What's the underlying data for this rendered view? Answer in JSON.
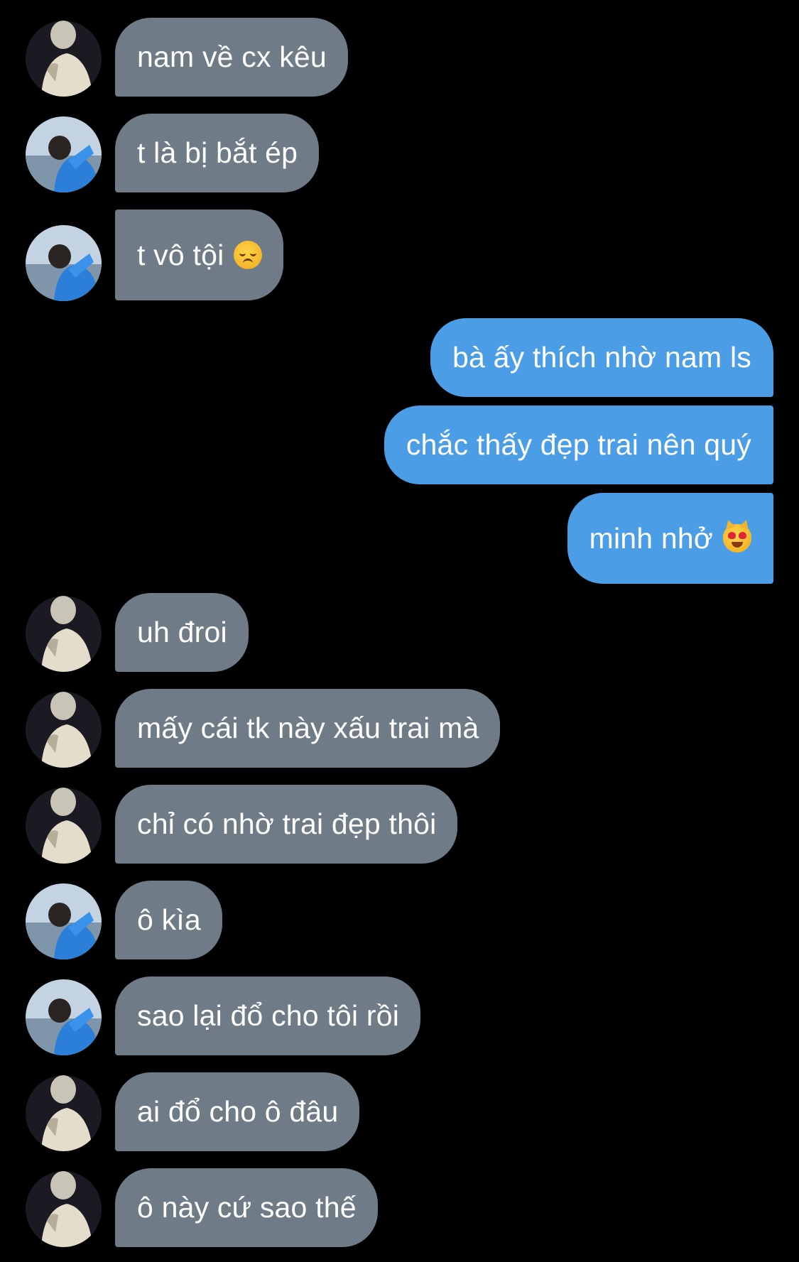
{
  "conversation": {
    "messages": [
      {
        "side": "in",
        "avatar": "dark-portrait-avatar",
        "text": "nam về cx kêu",
        "emoji": ""
      },
      {
        "side": "in",
        "avatar": "blue-jacket-avatar",
        "text": "t là bị bắt ép",
        "emoji": ""
      },
      {
        "side": "in",
        "avatar": "blue-jacket-avatar",
        "text": "t vô tội",
        "emoji": "disappointed-face-emoji"
      },
      {
        "side": "out",
        "avatar": "",
        "text": "bà ấy thích nhờ nam ls",
        "emoji": ""
      },
      {
        "side": "out",
        "avatar": "",
        "text": "chắc thấy đẹp trai nên quý",
        "emoji": ""
      },
      {
        "side": "out",
        "avatar": "",
        "text": "minh nhở",
        "emoji": "heart-eyes-cat-emoji"
      },
      {
        "side": "in",
        "avatar": "dark-portrait-avatar",
        "text": "uh đroi",
        "emoji": ""
      },
      {
        "side": "in",
        "avatar": "dark-portrait-avatar",
        "text": "mấy cái tk này xấu trai mà",
        "emoji": ""
      },
      {
        "side": "in",
        "avatar": "dark-portrait-avatar",
        "text": "chỉ có nhờ trai đẹp thôi",
        "emoji": ""
      },
      {
        "side": "in",
        "avatar": "blue-jacket-avatar",
        "text": "ô kìa",
        "emoji": ""
      },
      {
        "side": "in",
        "avatar": "blue-jacket-avatar",
        "text": "sao lại đổ cho tôi rồi",
        "emoji": ""
      },
      {
        "side": "in",
        "avatar": "dark-portrait-avatar",
        "text": "ai đổ cho ô đâu",
        "emoji": ""
      },
      {
        "side": "in",
        "avatar": "dark-portrait-avatar",
        "text": "ô này cứ sao thế",
        "emoji": ""
      }
    ]
  },
  "colors": {
    "background": "#000000",
    "incoming_bubble": "#6f7b87",
    "outgoing_bubble": "#4b9ee6",
    "bubble_text": "#ffffff"
  }
}
